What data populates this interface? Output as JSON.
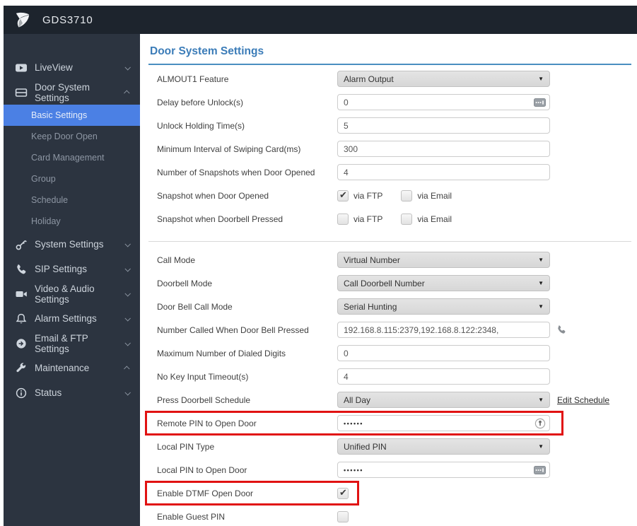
{
  "header": {
    "title": "GDS3710",
    "logo": "grandstream-logo"
  },
  "sidebar": {
    "items": [
      {
        "label": "LiveView",
        "icon": "liveview-icon",
        "chevron": "down"
      },
      {
        "label": "Door System Settings",
        "icon": "door-system-icon",
        "chevron": "up",
        "children": [
          {
            "label": "Basic Settings",
            "active": true
          },
          {
            "label": "Keep Door Open"
          },
          {
            "label": "Card Management"
          },
          {
            "label": "Group"
          },
          {
            "label": "Schedule"
          },
          {
            "label": "Holiday"
          }
        ]
      },
      {
        "label": "System Settings",
        "icon": "system-settings-icon",
        "chevron": "down"
      },
      {
        "label": "SIP Settings",
        "icon": "sip-settings-icon",
        "chevron": "down"
      },
      {
        "label": "Video & Audio Settings",
        "icon": "video-audio-icon",
        "chevron": "down"
      },
      {
        "label": "Alarm Settings",
        "icon": "alarm-settings-icon",
        "chevron": "down"
      },
      {
        "label": "Email & FTP Settings",
        "icon": "email-ftp-icon",
        "chevron": "down"
      },
      {
        "label": "Maintenance",
        "icon": "maintenance-icon",
        "chevron": "up"
      },
      {
        "label": "Status",
        "icon": "status-icon",
        "chevron": "down"
      }
    ]
  },
  "main": {
    "title": "Door System Settings",
    "colors": {
      "accent_blue": "#3b7cb8",
      "active_sidebar_item": "#4b80e4",
      "highlight_red": "#e11212"
    },
    "sections": [
      {
        "rows": [
          {
            "label": "ALMOUT1 Feature",
            "control": {
              "type": "select",
              "value": "Alarm Output"
            }
          },
          {
            "label": "Delay before Unlock(s)",
            "control": {
              "type": "text",
              "value": "0",
              "icon": "keypad-icon"
            }
          },
          {
            "label": "Unlock Holding Time(s)",
            "control": {
              "type": "text",
              "value": "5"
            }
          },
          {
            "label": "Minimum Interval of Swiping Card(ms)",
            "control": {
              "type": "text",
              "value": "300"
            }
          },
          {
            "label": "Number of Snapshots when Door Opened",
            "control": {
              "type": "text",
              "value": "4"
            }
          },
          {
            "label": "Snapshot when Door Opened",
            "control": {
              "type": "checkgroup",
              "options": [
                {
                  "label": "via FTP",
                  "checked": true
                },
                {
                  "label": "via Email",
                  "checked": false
                }
              ]
            }
          },
          {
            "label": "Snapshot when Doorbell Pressed",
            "control": {
              "type": "checkgroup",
              "options": [
                {
                  "label": "via FTP",
                  "checked": false
                },
                {
                  "label": "via Email",
                  "checked": false
                }
              ]
            }
          }
        ]
      },
      {
        "rows": [
          {
            "label": "Call Mode",
            "control": {
              "type": "select",
              "value": "Virtual Number"
            }
          },
          {
            "label": "Doorbell Mode",
            "control": {
              "type": "select",
              "value": "Call Doorbell Number"
            }
          },
          {
            "label": "Door Bell Call Mode",
            "control": {
              "type": "select",
              "value": "Serial Hunting"
            }
          },
          {
            "label": "Number Called When Door Bell Pressed",
            "control": {
              "type": "text",
              "value": "192.168.8.115:2379,192.168.8.122:2348,",
              "trailing_icon": "phone-icon"
            }
          },
          {
            "label": "Maximum Number of Dialed Digits",
            "control": {
              "type": "text",
              "value": "0"
            }
          },
          {
            "label": "No Key Input Timeout(s)",
            "control": {
              "type": "text",
              "value": "4"
            }
          },
          {
            "label": "Press Doorbell Schedule",
            "control": {
              "type": "select",
              "value": "All Day",
              "link": "Edit Schedule"
            }
          },
          {
            "label": "Remote PIN to Open Door",
            "control": {
              "type": "password",
              "value": "••••••",
              "icon": "viewer-icon"
            },
            "highlight": "wide"
          },
          {
            "label": "Local PIN Type",
            "control": {
              "type": "select",
              "value": "Unified PIN"
            }
          },
          {
            "label": "Local PIN to Open Door",
            "control": {
              "type": "password",
              "value": "••••••",
              "icon": "keypad-icon"
            }
          },
          {
            "label": "Enable DTMF Open Door",
            "control": {
              "type": "checkbox",
              "checked": true
            },
            "highlight": "narrow"
          },
          {
            "label": "Enable Guest PIN",
            "control": {
              "type": "checkbox",
              "checked": false
            }
          }
        ]
      }
    ]
  }
}
